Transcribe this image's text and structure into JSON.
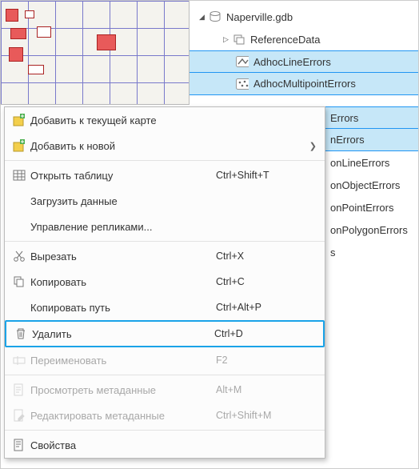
{
  "tree": {
    "root": "Naperville.gdb",
    "group": "ReferenceData",
    "items": [
      {
        "label": "AdhocLineErrors",
        "selected": true
      },
      {
        "label": "AdhocMultipointErrors",
        "selected": true
      }
    ],
    "partial_items": [
      {
        "label": "Errors",
        "selected": true
      },
      {
        "label": "nErrors",
        "selected": true
      },
      {
        "label": "onLineErrors",
        "selected": false
      },
      {
        "label": "onObjectErrors",
        "selected": false
      },
      {
        "label": "onPointErrors",
        "selected": false
      },
      {
        "label": "onPolygonErrors",
        "selected": false
      },
      {
        "label": "s",
        "selected": false
      }
    ]
  },
  "context_menu": [
    {
      "icon": "add-map-icon",
      "label": "Добавить к текущей карте",
      "shortcut": "",
      "disabled": false,
      "submenu": false
    },
    {
      "icon": "add-new-icon",
      "label": "Добавить к новой",
      "shortcut": "",
      "disabled": false,
      "submenu": true
    },
    {
      "sep": true
    },
    {
      "icon": "table-icon",
      "label": "Открыть таблицу",
      "shortcut": "Ctrl+Shift+T",
      "disabled": false
    },
    {
      "icon": "",
      "label": "Загрузить данные",
      "shortcut": "",
      "disabled": false
    },
    {
      "icon": "",
      "label": "Управление репликами...",
      "shortcut": "",
      "disabled": false
    },
    {
      "sep": true
    },
    {
      "icon": "cut-icon",
      "label": "Вырезать",
      "shortcut": "Ctrl+X",
      "disabled": false
    },
    {
      "icon": "copy-icon",
      "label": "Копировать",
      "shortcut": "Ctrl+C",
      "disabled": false
    },
    {
      "icon": "",
      "label": "Копировать путь",
      "shortcut": "Ctrl+Alt+P",
      "disabled": false
    },
    {
      "icon": "delete-icon",
      "label": "Удалить",
      "shortcut": "Ctrl+D",
      "disabled": false,
      "highlight": true
    },
    {
      "icon": "rename-icon",
      "label": "Переименовать",
      "shortcut": "F2",
      "disabled": true
    },
    {
      "sep": true
    },
    {
      "icon": "view-meta-icon",
      "label": "Просмотреть метаданные",
      "shortcut": "Alt+M",
      "disabled": true
    },
    {
      "icon": "edit-meta-icon",
      "label": "Редактировать метаданные",
      "shortcut": "Ctrl+Shift+M",
      "disabled": true
    },
    {
      "sep": true
    },
    {
      "icon": "properties-icon",
      "label": "Свойства",
      "shortcut": "",
      "disabled": false
    }
  ]
}
